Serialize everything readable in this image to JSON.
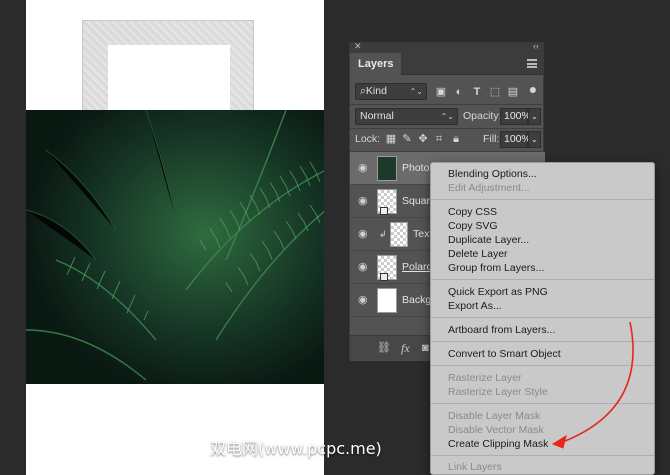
{
  "panel": {
    "title": "Layers",
    "filter": {
      "label": "Kind"
    },
    "blend": {
      "mode": "Normal",
      "opacity_label": "Opacity:",
      "opacity_value": "100%"
    },
    "lock": {
      "label": "Lock:",
      "fill_label": "Fill:",
      "fill_value": "100%"
    },
    "layers": [
      {
        "name": "Photo",
        "selected": true
      },
      {
        "name": "Square"
      },
      {
        "name": "Text"
      },
      {
        "name": "Polaroid"
      },
      {
        "name": "Background"
      }
    ],
    "footer": {
      "fx_label": "fx"
    }
  },
  "context_menu": {
    "items": [
      {
        "label": "Blending Options...",
        "enabled": true
      },
      {
        "label": "Edit Adjustment...",
        "enabled": false
      },
      {
        "label": "Copy CSS",
        "enabled": true
      },
      {
        "label": "Copy SVG",
        "enabled": true
      },
      {
        "label": "Duplicate Layer...",
        "enabled": true
      },
      {
        "label": "Delete Layer",
        "enabled": true
      },
      {
        "label": "Group from Layers...",
        "enabled": true
      },
      {
        "label": "Quick Export as PNG",
        "enabled": true
      },
      {
        "label": "Export As...",
        "enabled": true
      },
      {
        "label": "Artboard from Layers...",
        "enabled": true
      },
      {
        "label": "Convert to Smart Object",
        "enabled": true
      },
      {
        "label": "Rasterize Layer",
        "enabled": false
      },
      {
        "label": "Rasterize Layer Style",
        "enabled": false
      },
      {
        "label": "Disable Layer Mask",
        "enabled": false
      },
      {
        "label": "Disable Vector Mask",
        "enabled": false
      },
      {
        "label": "Create Clipping Mask",
        "enabled": true
      },
      {
        "label": "Link Layers",
        "enabled": false
      }
    ]
  },
  "watermark": "双电网(www.pcpc.me)",
  "colors": {
    "annotation_arrow": "#e8261a",
    "panel_bg": "#535353",
    "menu_bg": "#c9c9c9"
  }
}
